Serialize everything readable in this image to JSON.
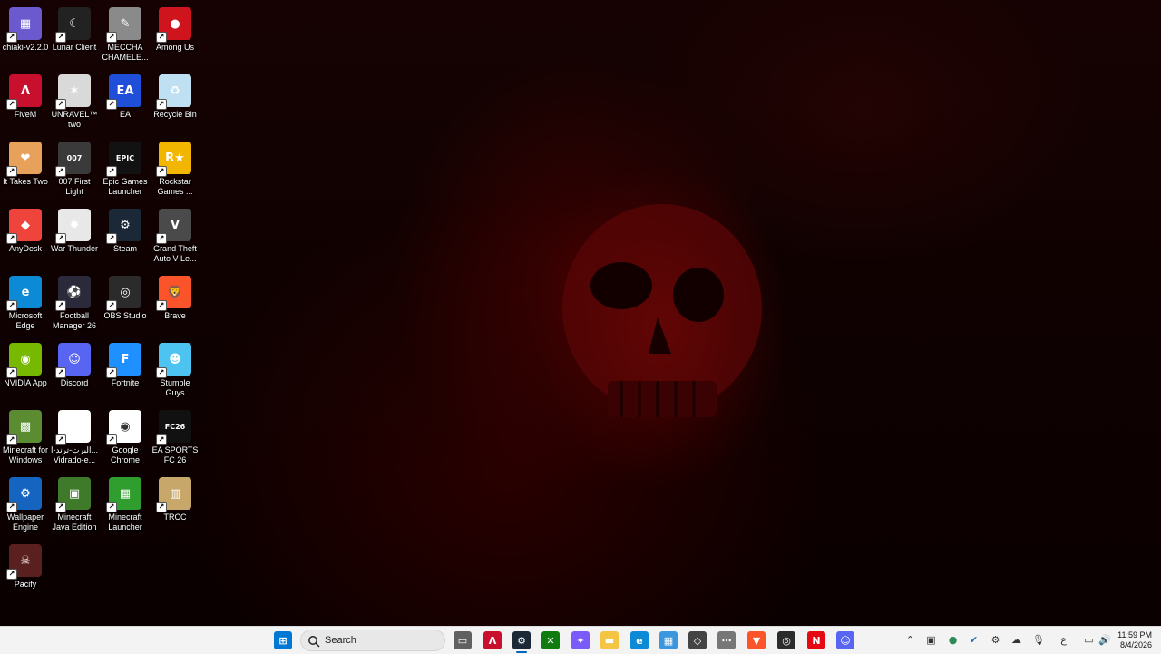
{
  "desktop": {
    "icons": [
      {
        "label": "chiaki-v2.2.0",
        "icon": "chiaki-icon",
        "color": "#6a5acd",
        "glyph": "▦"
      },
      {
        "label": "Lunar Client",
        "icon": "lunar-client-icon",
        "color": "#222222",
        "glyph": "☾"
      },
      {
        "label": "MECCHA CHAMELE...",
        "icon": "meccha-chameleon-icon",
        "color": "#8a8a8a",
        "glyph": "✎"
      },
      {
        "label": "Among Us",
        "icon": "among-us-icon",
        "color": "#d0141e",
        "glyph": "●"
      },
      {
        "label": "FiveM",
        "icon": "fivem-icon",
        "color": "#c8102e",
        "glyph": "Λ"
      },
      {
        "label": "UNRAVEL™ two",
        "icon": "unravel-two-icon",
        "color": "#d9d9d9",
        "glyph": "✶"
      },
      {
        "label": "EA",
        "icon": "ea-icon",
        "color": "#1f4fd8",
        "glyph": "EA"
      },
      {
        "label": "Recycle Bin",
        "icon": "recycle-bin-icon",
        "color": "#bfe0f2",
        "glyph": "♻"
      },
      {
        "label": "It Takes Two",
        "icon": "it-takes-two-icon",
        "color": "#e8a15a",
        "glyph": "❤"
      },
      {
        "label": "007 First Light",
        "icon": "first-light-icon",
        "color": "#3a3a3a",
        "glyph": "007"
      },
      {
        "label": "Epic Games Launcher",
        "icon": "epic-games-icon",
        "color": "#121212",
        "glyph": "EPIC"
      },
      {
        "label": "Rockstar Games ...",
        "icon": "rockstar-icon",
        "color": "#f2b600",
        "glyph": "R★"
      },
      {
        "label": "AnyDesk",
        "icon": "anydesk-icon",
        "color": "#ef443b",
        "glyph": "◆"
      },
      {
        "label": "War Thunder",
        "icon": "war-thunder-icon",
        "color": "#e8e8e8",
        "glyph": "✹"
      },
      {
        "label": "Steam",
        "icon": "steam-icon",
        "color": "#1b2838",
        "glyph": "⚙"
      },
      {
        "label": "Grand Theft Auto V Le...",
        "icon": "gta-v-icon",
        "color": "#4a4a4a",
        "glyph": "V"
      },
      {
        "label": "Microsoft Edge",
        "icon": "edge-icon",
        "color": "#0c8ad6",
        "glyph": "e"
      },
      {
        "label": "Football Manager 26",
        "icon": "football-manager-icon",
        "color": "#2a2a3a",
        "glyph": "⚽"
      },
      {
        "label": "OBS Studio",
        "icon": "obs-icon",
        "color": "#2b2b2b",
        "glyph": "◎"
      },
      {
        "label": "Brave",
        "icon": "brave-icon",
        "color": "#fb542b",
        "glyph": "🦁"
      },
      {
        "label": "NVIDIA App",
        "icon": "nvidia-icon",
        "color": "#76b900",
        "glyph": "◉"
      },
      {
        "label": "Discord",
        "icon": "discord-icon",
        "color": "#5865f2",
        "glyph": "☺"
      },
      {
        "label": "Fortnite",
        "icon": "fortnite-icon",
        "color": "#1e90ff",
        "glyph": "F"
      },
      {
        "label": "Stumble Guys",
        "icon": "stumble-guys-icon",
        "color": "#4cc3f0",
        "glyph": "☻"
      },
      {
        "label": "Minecraft for Windows",
        "icon": "minecraft-windows-icon",
        "color": "#5b8c32",
        "glyph": "▩"
      },
      {
        "label": "البرت-ترند-ا... Vidrado-e...",
        "icon": "file-icon",
        "color": "#ffffff",
        "glyph": ""
      },
      {
        "label": "Google Chrome",
        "icon": "chrome-icon",
        "color": "#ffffff",
        "glyph": "◉"
      },
      {
        "label": "EA SPORTS FC 26",
        "icon": "ea-fc-icon",
        "color": "#111111",
        "glyph": "FC26"
      },
      {
        "label": "Wallpaper Engine",
        "icon": "wallpaper-engine-icon",
        "color": "#1565c0",
        "glyph": "⚙"
      },
      {
        "label": "Minecraft Java Edition",
        "icon": "minecraft-java-icon",
        "color": "#3f7a2a",
        "glyph": "▣"
      },
      {
        "label": "Minecraft Launcher",
        "icon": "minecraft-launcher-icon",
        "color": "#2f9e2f",
        "glyph": "▦"
      },
      {
        "label": "TRCC",
        "icon": "trcc-icon",
        "color": "#c8a86a",
        "glyph": "▥"
      },
      {
        "label": "Pacify",
        "icon": "pacify-icon",
        "color": "#5a2020",
        "glyph": "☠"
      }
    ]
  },
  "taskbar": {
    "search_label": "Search",
    "apps": [
      {
        "name": "start-button",
        "icon": "windows-start-icon",
        "color": "#0078d4",
        "glyph": "⊞"
      },
      {
        "name": "task-view-button",
        "icon": "task-view-icon",
        "color": "#606060",
        "glyph": "▭"
      },
      {
        "name": "taskbar-fivem",
        "icon": "fivem-icon",
        "color": "#c8102e",
        "glyph": "Λ"
      },
      {
        "name": "taskbar-steam",
        "icon": "steam-icon",
        "color": "#1b2838",
        "glyph": "⚙"
      },
      {
        "name": "taskbar-xbox",
        "icon": "xbox-icon",
        "color": "#107c10",
        "glyph": "✕"
      },
      {
        "name": "taskbar-copilot",
        "icon": "copilot-icon",
        "color": "#7a5af8",
        "glyph": "✦"
      },
      {
        "name": "taskbar-file-explorer",
        "icon": "folder-icon",
        "color": "#f4c542",
        "glyph": "▬"
      },
      {
        "name": "taskbar-edge",
        "icon": "edge-icon",
        "color": "#0c8ad6",
        "glyph": "e"
      },
      {
        "name": "taskbar-store",
        "icon": "store-icon",
        "color": "#3a96dd",
        "glyph": "▦"
      },
      {
        "name": "taskbar-unity",
        "icon": "unity-icon",
        "color": "#444444",
        "glyph": "◇"
      },
      {
        "name": "taskbar-app-dots",
        "icon": "dots-icon",
        "color": "#777777",
        "glyph": "⋯"
      },
      {
        "name": "taskbar-brave",
        "icon": "brave-icon",
        "color": "#fb542b",
        "glyph": "▼"
      },
      {
        "name": "taskbar-obs",
        "icon": "obs-icon",
        "color": "#2b2b2b",
        "glyph": "◎"
      },
      {
        "name": "taskbar-netflix",
        "icon": "netflix-icon",
        "color": "#e50914",
        "glyph": "N"
      },
      {
        "name": "taskbar-discord",
        "icon": "discord-icon",
        "color": "#5865f2",
        "glyph": "☺"
      }
    ],
    "tray": {
      "language": "ع",
      "time": "11:59 PM",
      "date": "8/4/2026"
    }
  }
}
